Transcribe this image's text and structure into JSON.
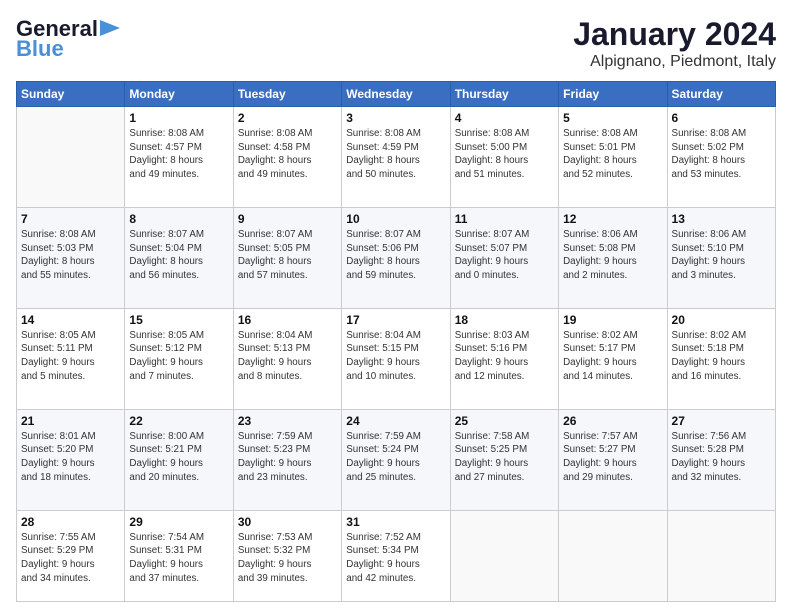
{
  "header": {
    "logo_main": "General",
    "logo_sub": "Blue",
    "month": "January 2024",
    "location": "Alpignano, Piedmont, Italy"
  },
  "weekdays": [
    "Sunday",
    "Monday",
    "Tuesday",
    "Wednesday",
    "Thursday",
    "Friday",
    "Saturday"
  ],
  "weeks": [
    [
      {
        "day": "",
        "info": ""
      },
      {
        "day": "1",
        "info": "Sunrise: 8:08 AM\nSunset: 4:57 PM\nDaylight: 8 hours\nand 49 minutes."
      },
      {
        "day": "2",
        "info": "Sunrise: 8:08 AM\nSunset: 4:58 PM\nDaylight: 8 hours\nand 49 minutes."
      },
      {
        "day": "3",
        "info": "Sunrise: 8:08 AM\nSunset: 4:59 PM\nDaylight: 8 hours\nand 50 minutes."
      },
      {
        "day": "4",
        "info": "Sunrise: 8:08 AM\nSunset: 5:00 PM\nDaylight: 8 hours\nand 51 minutes."
      },
      {
        "day": "5",
        "info": "Sunrise: 8:08 AM\nSunset: 5:01 PM\nDaylight: 8 hours\nand 52 minutes."
      },
      {
        "day": "6",
        "info": "Sunrise: 8:08 AM\nSunset: 5:02 PM\nDaylight: 8 hours\nand 53 minutes."
      }
    ],
    [
      {
        "day": "7",
        "info": "Sunrise: 8:08 AM\nSunset: 5:03 PM\nDaylight: 8 hours\nand 55 minutes."
      },
      {
        "day": "8",
        "info": "Sunrise: 8:07 AM\nSunset: 5:04 PM\nDaylight: 8 hours\nand 56 minutes."
      },
      {
        "day": "9",
        "info": "Sunrise: 8:07 AM\nSunset: 5:05 PM\nDaylight: 8 hours\nand 57 minutes."
      },
      {
        "day": "10",
        "info": "Sunrise: 8:07 AM\nSunset: 5:06 PM\nDaylight: 8 hours\nand 59 minutes."
      },
      {
        "day": "11",
        "info": "Sunrise: 8:07 AM\nSunset: 5:07 PM\nDaylight: 9 hours\nand 0 minutes."
      },
      {
        "day": "12",
        "info": "Sunrise: 8:06 AM\nSunset: 5:08 PM\nDaylight: 9 hours\nand 2 minutes."
      },
      {
        "day": "13",
        "info": "Sunrise: 8:06 AM\nSunset: 5:10 PM\nDaylight: 9 hours\nand 3 minutes."
      }
    ],
    [
      {
        "day": "14",
        "info": "Sunrise: 8:05 AM\nSunset: 5:11 PM\nDaylight: 9 hours\nand 5 minutes."
      },
      {
        "day": "15",
        "info": "Sunrise: 8:05 AM\nSunset: 5:12 PM\nDaylight: 9 hours\nand 7 minutes."
      },
      {
        "day": "16",
        "info": "Sunrise: 8:04 AM\nSunset: 5:13 PM\nDaylight: 9 hours\nand 8 minutes."
      },
      {
        "day": "17",
        "info": "Sunrise: 8:04 AM\nSunset: 5:15 PM\nDaylight: 9 hours\nand 10 minutes."
      },
      {
        "day": "18",
        "info": "Sunrise: 8:03 AM\nSunset: 5:16 PM\nDaylight: 9 hours\nand 12 minutes."
      },
      {
        "day": "19",
        "info": "Sunrise: 8:02 AM\nSunset: 5:17 PM\nDaylight: 9 hours\nand 14 minutes."
      },
      {
        "day": "20",
        "info": "Sunrise: 8:02 AM\nSunset: 5:18 PM\nDaylight: 9 hours\nand 16 minutes."
      }
    ],
    [
      {
        "day": "21",
        "info": "Sunrise: 8:01 AM\nSunset: 5:20 PM\nDaylight: 9 hours\nand 18 minutes."
      },
      {
        "day": "22",
        "info": "Sunrise: 8:00 AM\nSunset: 5:21 PM\nDaylight: 9 hours\nand 20 minutes."
      },
      {
        "day": "23",
        "info": "Sunrise: 7:59 AM\nSunset: 5:23 PM\nDaylight: 9 hours\nand 23 minutes."
      },
      {
        "day": "24",
        "info": "Sunrise: 7:59 AM\nSunset: 5:24 PM\nDaylight: 9 hours\nand 25 minutes."
      },
      {
        "day": "25",
        "info": "Sunrise: 7:58 AM\nSunset: 5:25 PM\nDaylight: 9 hours\nand 27 minutes."
      },
      {
        "day": "26",
        "info": "Sunrise: 7:57 AM\nSunset: 5:27 PM\nDaylight: 9 hours\nand 29 minutes."
      },
      {
        "day": "27",
        "info": "Sunrise: 7:56 AM\nSunset: 5:28 PM\nDaylight: 9 hours\nand 32 minutes."
      }
    ],
    [
      {
        "day": "28",
        "info": "Sunrise: 7:55 AM\nSunset: 5:29 PM\nDaylight: 9 hours\nand 34 minutes."
      },
      {
        "day": "29",
        "info": "Sunrise: 7:54 AM\nSunset: 5:31 PM\nDaylight: 9 hours\nand 37 minutes."
      },
      {
        "day": "30",
        "info": "Sunrise: 7:53 AM\nSunset: 5:32 PM\nDaylight: 9 hours\nand 39 minutes."
      },
      {
        "day": "31",
        "info": "Sunrise: 7:52 AM\nSunset: 5:34 PM\nDaylight: 9 hours\nand 42 minutes."
      },
      {
        "day": "",
        "info": ""
      },
      {
        "day": "",
        "info": ""
      },
      {
        "day": "",
        "info": ""
      }
    ]
  ]
}
